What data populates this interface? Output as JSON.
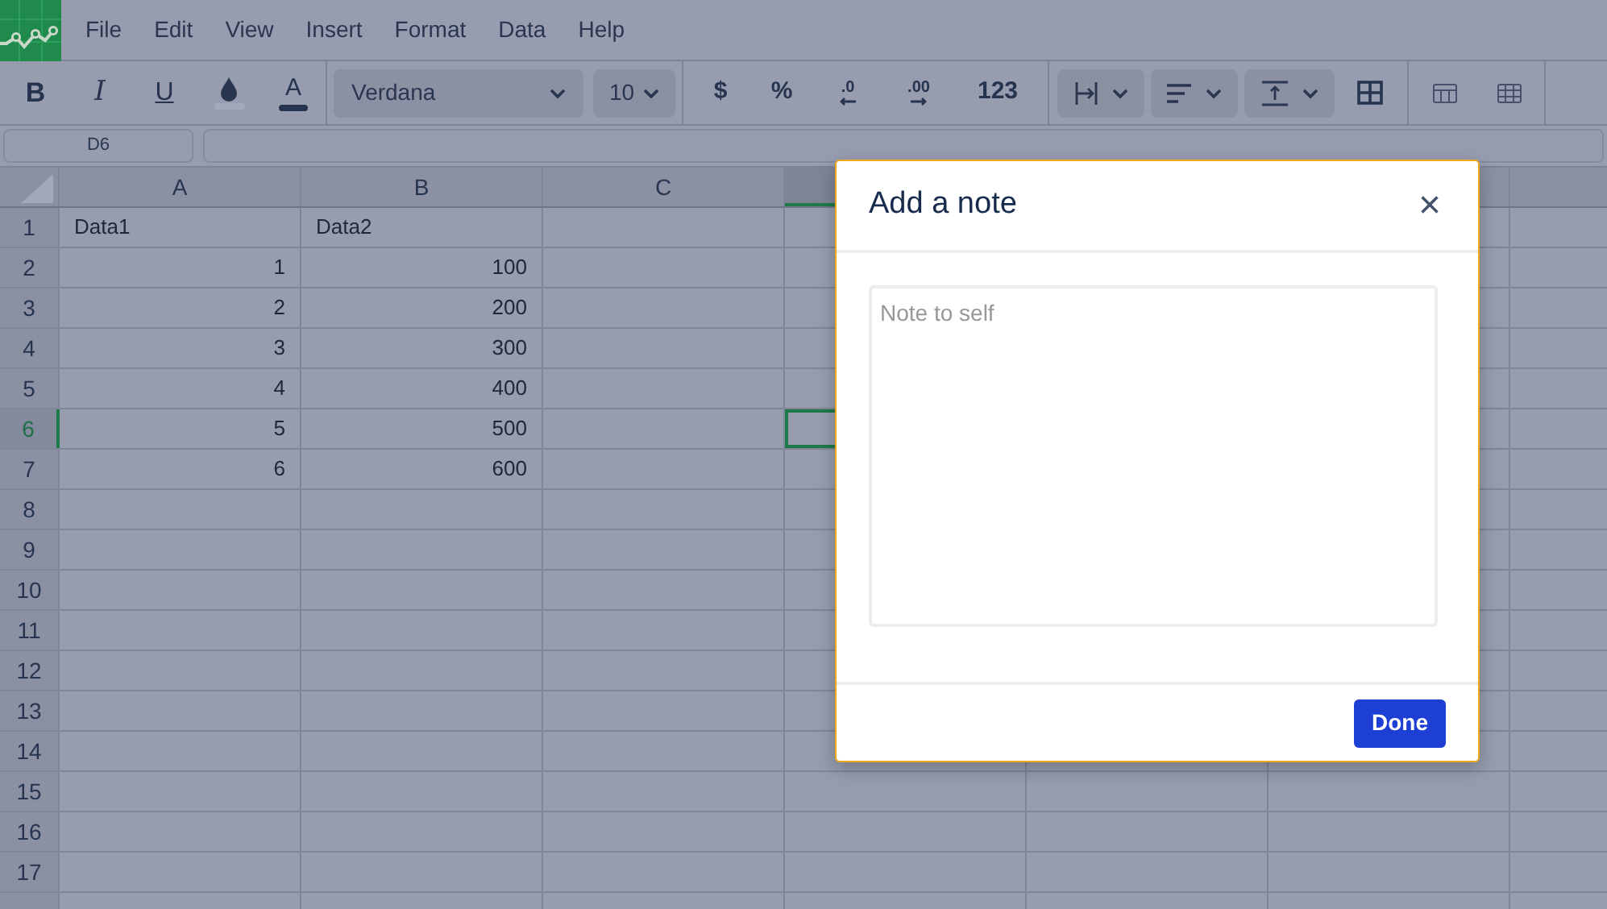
{
  "menu": [
    "File",
    "Edit",
    "View",
    "Insert",
    "Format",
    "Data",
    "Help"
  ],
  "toolbar": {
    "bold": "B",
    "italic": "I",
    "underline": "U",
    "text_color": "A",
    "font": "Verdana",
    "font_size": "10",
    "currency": "$",
    "percent": "%",
    "decrease_decimals": ".0",
    "increase_decimals": ".00",
    "number_format": "123"
  },
  "name_box": "D6",
  "columns": [
    "A",
    "B",
    "C"
  ],
  "rows": [
    {
      "number": "1",
      "cells": [
        "Data1",
        "Data2"
      ],
      "selected": false
    },
    {
      "number": "2",
      "cells": [
        "1",
        "100"
      ],
      "selected": false
    },
    {
      "number": "3",
      "cells": [
        "2",
        "200"
      ],
      "selected": false
    },
    {
      "number": "4",
      "cells": [
        "3",
        "300"
      ],
      "selected": false
    },
    {
      "number": "5",
      "cells": [
        "4",
        "400"
      ],
      "selected": false
    },
    {
      "number": "6",
      "cells": [
        "5",
        "500"
      ],
      "selected": true
    },
    {
      "number": "7",
      "cells": [
        "6",
        "600"
      ],
      "selected": false
    },
    {
      "number": "8",
      "cells": [],
      "selected": false
    },
    {
      "number": "9",
      "cells": [],
      "selected": false
    },
    {
      "number": "10",
      "cells": [],
      "selected": false
    },
    {
      "number": "11",
      "cells": [],
      "selected": false
    },
    {
      "number": "12",
      "cells": [],
      "selected": false
    },
    {
      "number": "13",
      "cells": [],
      "selected": false
    },
    {
      "number": "14",
      "cells": [],
      "selected": false
    },
    {
      "number": "15",
      "cells": [],
      "selected": false
    },
    {
      "number": "16",
      "cells": [],
      "selected": false
    },
    {
      "number": "17",
      "cells": [],
      "selected": false
    }
  ],
  "dialog": {
    "title": "Add a note",
    "close": "×",
    "placeholder": "Note to self",
    "button": "Done"
  }
}
